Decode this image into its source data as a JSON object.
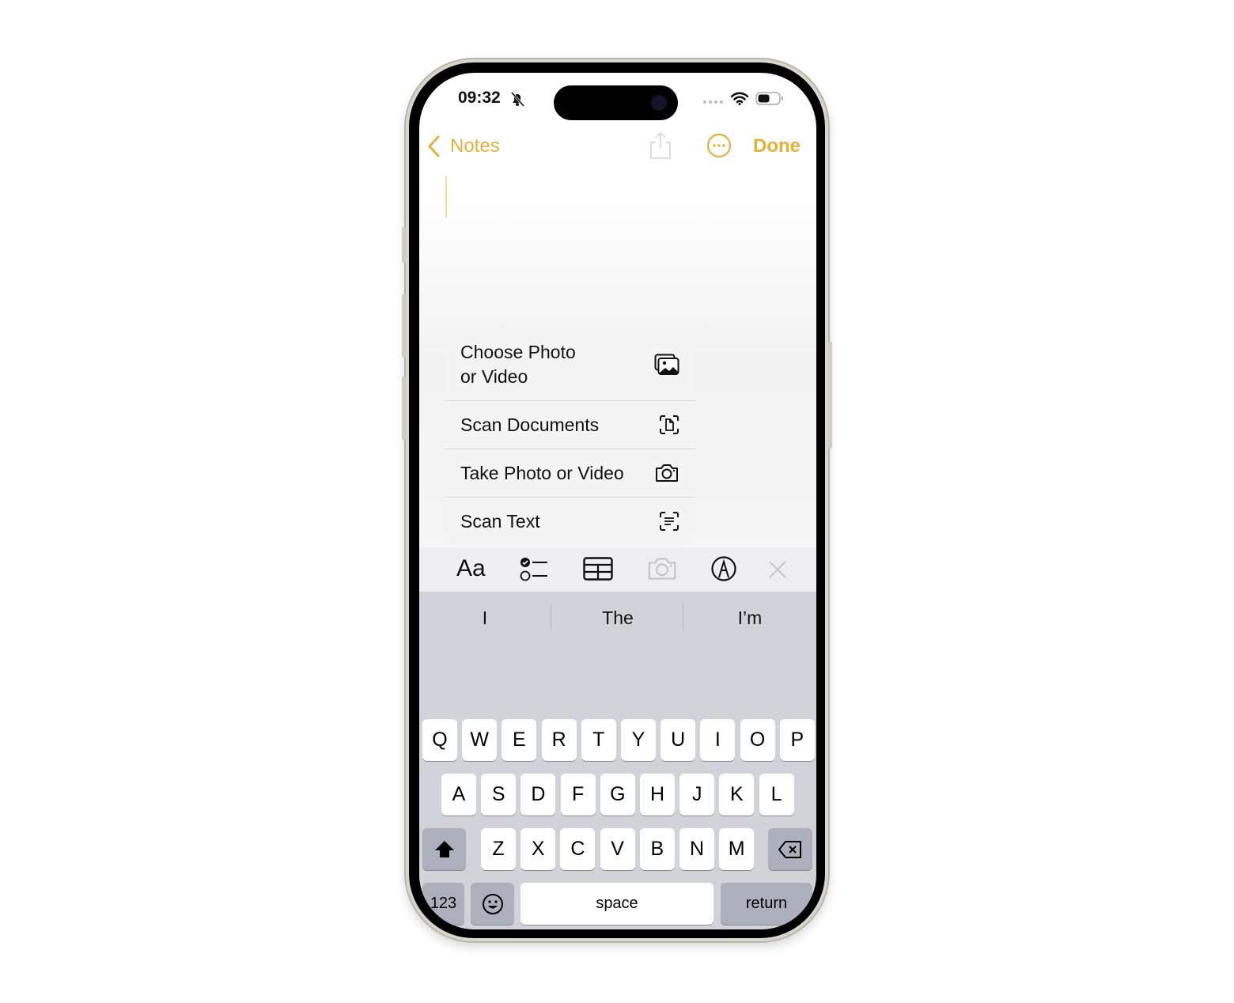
{
  "status": {
    "time": "09:32",
    "icons": [
      "bell-slash-icon",
      "cellular-dots-icon",
      "wifi-icon",
      "battery-icon"
    ]
  },
  "nav": {
    "back_label": "Notes",
    "done_label": "Done",
    "accent": "#e0b13c"
  },
  "menu": {
    "items": [
      {
        "label": "Choose Photo",
        "label2": "or Video",
        "icon": "photo-library-icon"
      },
      {
        "label": "Scan Documents",
        "icon": "scan-document-icon"
      },
      {
        "label": "Take Photo or Video",
        "icon": "camera-icon"
      },
      {
        "label": "Scan Text",
        "icon": "scan-text-icon"
      }
    ]
  },
  "toolbar": {
    "format_label": "Aa"
  },
  "suggestions": [
    "I",
    "The",
    "I’m"
  ],
  "keyboard": {
    "row1": [
      "Q",
      "W",
      "E",
      "R",
      "T",
      "Y",
      "U",
      "I",
      "O",
      "P"
    ],
    "row2": [
      "A",
      "S",
      "D",
      "F",
      "G",
      "H",
      "J",
      "K",
      "L"
    ],
    "row3": [
      "Z",
      "X",
      "C",
      "V",
      "B",
      "N",
      "M"
    ],
    "numbers": "123",
    "space": "space",
    "return": "return"
  }
}
